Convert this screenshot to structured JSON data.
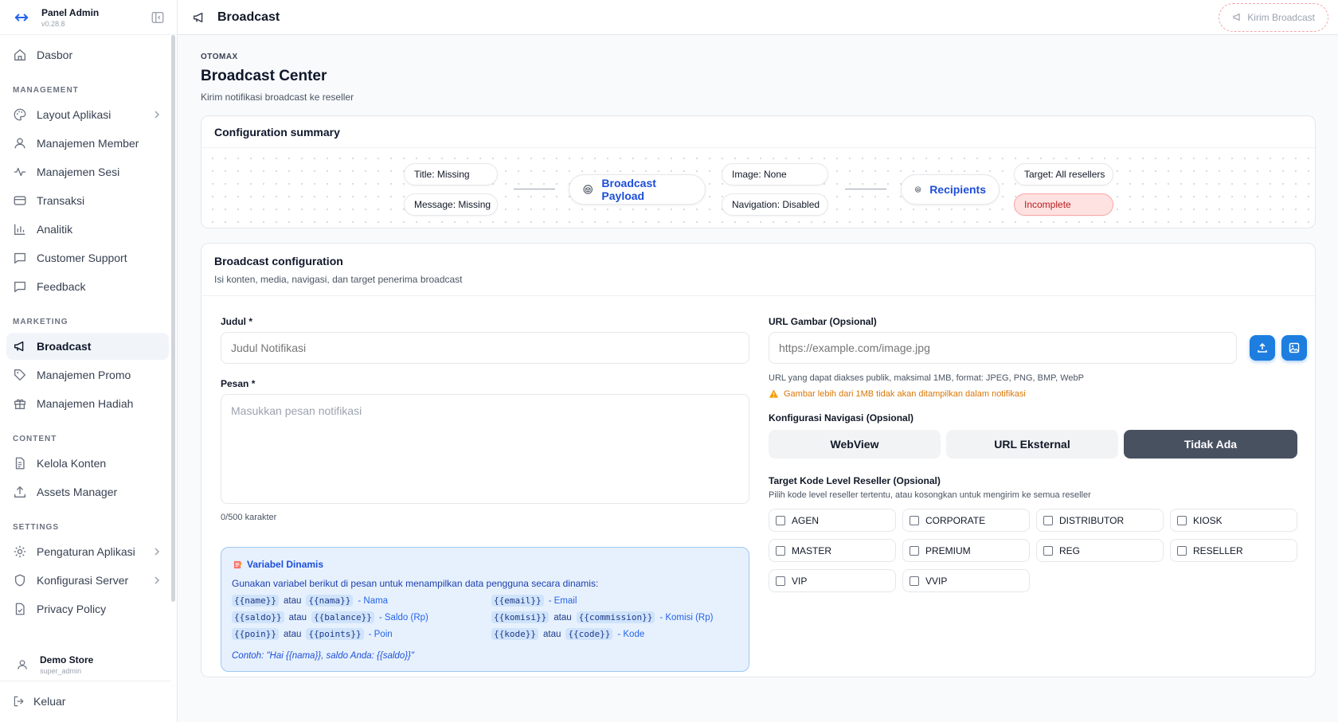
{
  "app": {
    "name": "Panel Admin",
    "version": "v0.28.8"
  },
  "sidebar": {
    "top": [
      {
        "label": "Dasbor"
      }
    ],
    "sections": [
      {
        "title": "MANAGEMENT",
        "items": [
          {
            "label": "Layout Aplikasi"
          },
          {
            "label": "Manajemen Member"
          },
          {
            "label": "Manajemen Sesi"
          },
          {
            "label": "Transaksi"
          },
          {
            "label": "Analitik"
          },
          {
            "label": "Customer Support"
          },
          {
            "label": "Feedback"
          }
        ]
      },
      {
        "title": "MARKETING",
        "items": [
          {
            "label": "Broadcast"
          },
          {
            "label": "Manajemen Promo"
          },
          {
            "label": "Manajemen Hadiah"
          }
        ]
      },
      {
        "title": "CONTENT",
        "items": [
          {
            "label": "Kelola Konten"
          },
          {
            "label": "Assets Manager"
          }
        ]
      },
      {
        "title": "SETTINGS",
        "items": [
          {
            "label": "Pengaturan Aplikasi"
          },
          {
            "label": "Konfigurasi Server"
          },
          {
            "label": "Privacy Policy"
          }
        ]
      }
    ],
    "user": {
      "name": "Demo Store",
      "role": "super_admin"
    },
    "logout": "Keluar"
  },
  "topbar": {
    "title": "Broadcast",
    "send_label": "Kirim Broadcast"
  },
  "page": {
    "eyebrow": "OTOMAX",
    "title": "Broadcast Center",
    "subtitle": "Kirim notifikasi broadcast ke reseller"
  },
  "summary": {
    "title": "Configuration summary",
    "title_pill": "Title: Missing",
    "message_pill": "Message: Missing",
    "payload_node": "Broadcast Payload",
    "image_pill": "Image: None",
    "navigation_pill": "Navigation: Disabled",
    "recipients_node": "Recipients",
    "target_pill": "Target: All resellers",
    "status_pill": "Incomplete",
    "status_color": "#b91c1c"
  },
  "config": {
    "title": "Broadcast configuration",
    "subtitle": "Isi konten, media, navigasi, dan target penerima broadcast",
    "judul_label": "Judul *",
    "judul_placeholder": "Judul Notifikasi",
    "pesan_label": "Pesan *",
    "pesan_placeholder": "Masukkan pesan notifikasi",
    "char_count": "0/500 karakter",
    "vars": {
      "title": "Variabel Dinamis",
      "desc": "Gunakan variabel berikut di pesan untuk menampilkan data pengguna secara dinamis:",
      "or": "atau",
      "rows": [
        {
          "a": "{{name}}",
          "b": "{{nama}}",
          "desc": "- Nama"
        },
        {
          "a": "{{email}}",
          "b": "",
          "desc": "- Email"
        },
        {
          "a": "{{saldo}}",
          "b": "{{balance}}",
          "desc": "- Saldo (Rp)"
        },
        {
          "a": "{{komisi}}",
          "b": "{{commission}}",
          "desc": "- Komisi (Rp)"
        },
        {
          "a": "{{poin}}",
          "b": "{{points}}",
          "desc": "- Poin"
        },
        {
          "a": "{{kode}}",
          "b": "{{code}}",
          "desc": "- Kode"
        }
      ],
      "example": "Contoh: \"Hai {{nama}}, saldo Anda: {{saldo}}\""
    },
    "url_label": "URL Gambar (Opsional)",
    "url_placeholder": "https://example.com/image.jpg",
    "url_hint": "URL yang dapat diakses publik, maksimal 1MB, format: JPEG, PNG, BMP, WebP",
    "url_warning": "Gambar lebih dari 1MB tidak akan ditampilkan dalam notifikasi",
    "nav_label": "Konfigurasi Navigasi (Opsional)",
    "nav_options": [
      "WebView",
      "URL Eksternal",
      "Tidak Ada"
    ],
    "nav_selected": "Tidak Ada",
    "target_label": "Target Kode Level Reseller (Opsional)",
    "target_hint": "Pilih kode level reseller tertentu, atau kosongkan untuk mengirim ke semua reseller",
    "levels": [
      "AGEN",
      "CORPORATE",
      "DISTRIBUTOR",
      "KIOSK",
      "MASTER",
      "PREMIUM",
      "REG",
      "RESELLER",
      "VIP",
      "VVIP"
    ]
  },
  "colors": {
    "accent": "#2563eb",
    "nav_selected_bg": "#475160",
    "warning": "#d97706"
  }
}
